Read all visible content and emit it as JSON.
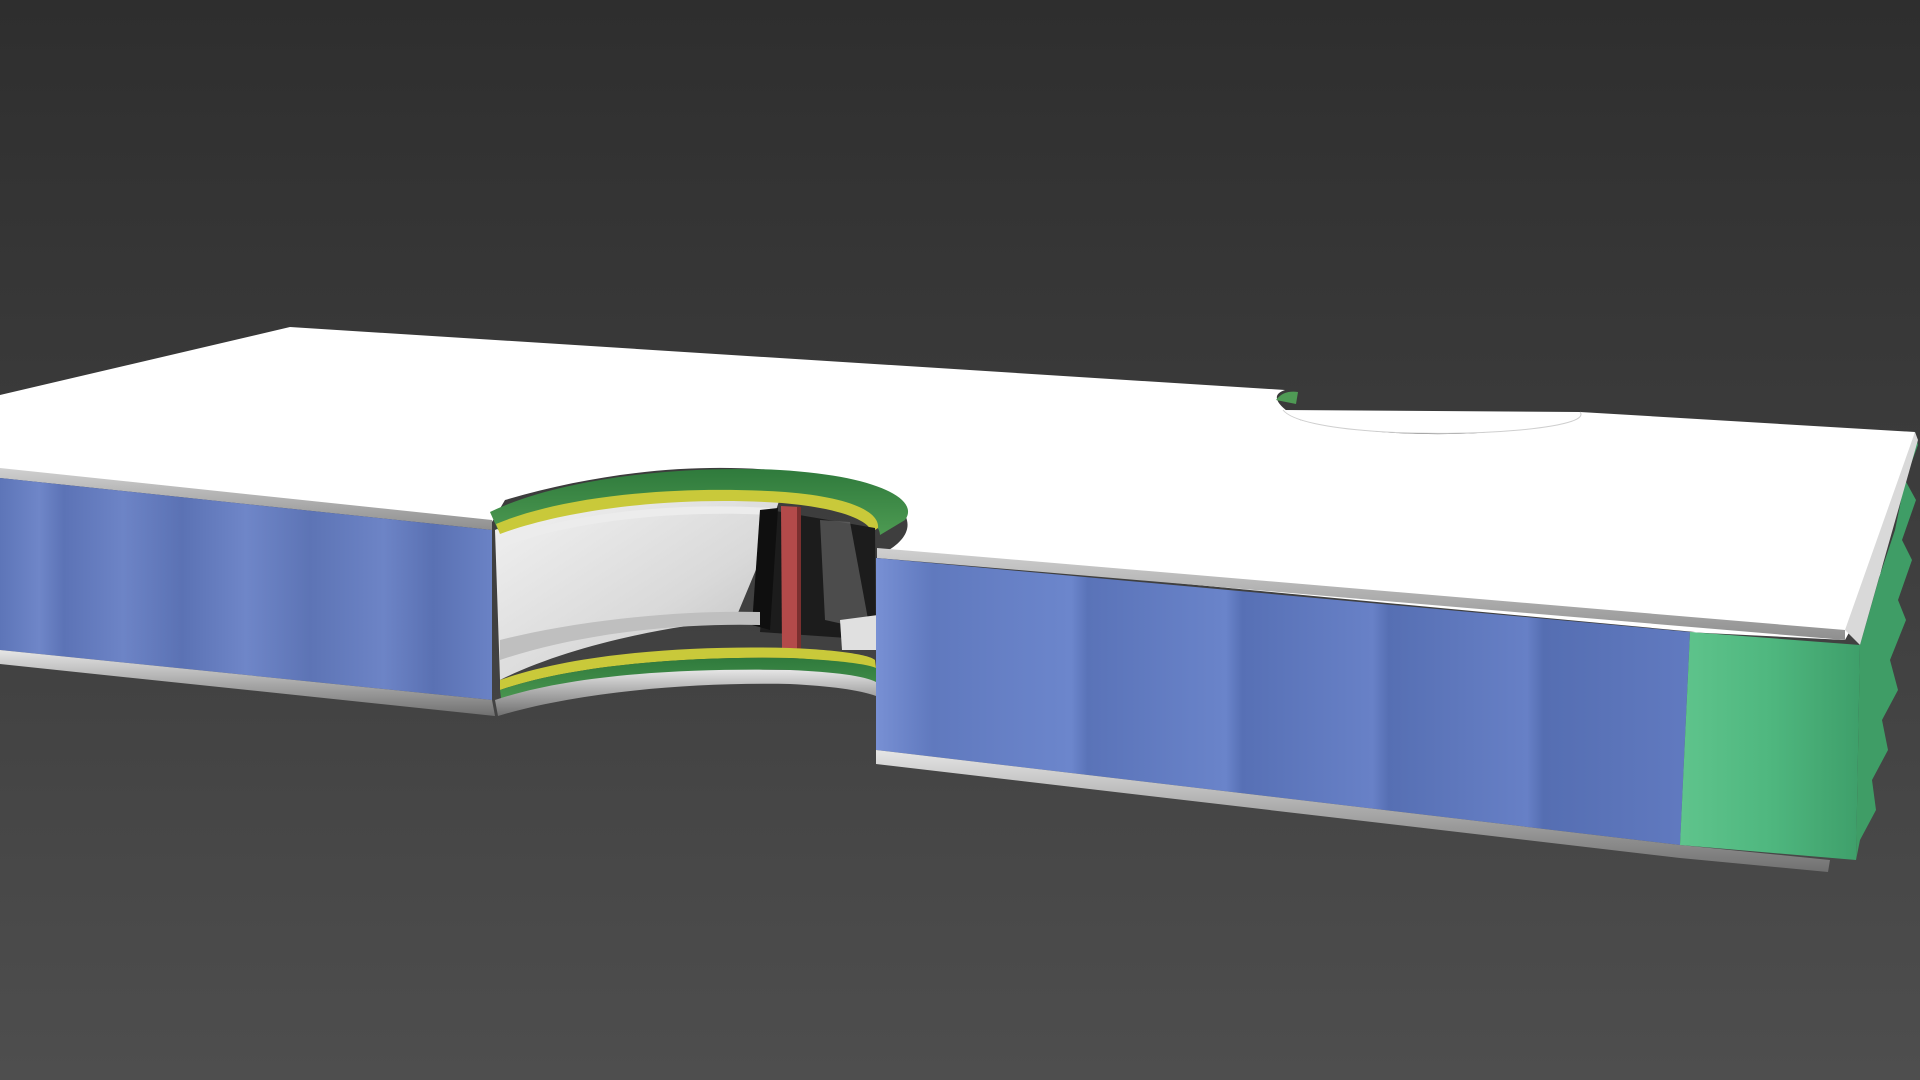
{
  "scene": {
    "kind": "3d-render",
    "subject": "sandwich-panel-cutaway",
    "colors": {
      "background_top": "#2f2f2f",
      "background_bottom": "#505050",
      "top_skin": "#ffffff",
      "bottom_skin": "#b8b8b8",
      "core_left": "#6f86c8",
      "core_right": "#6c86cc",
      "core_end": "#4fb77f",
      "insert_ring_green": "#3f8f4a",
      "insert_ring_yellow": "#c9c93a",
      "insert_web_red": "#b34a4a",
      "insert_interior": "#d8d8d8",
      "insert_dark": "#1a1a1a"
    }
  }
}
